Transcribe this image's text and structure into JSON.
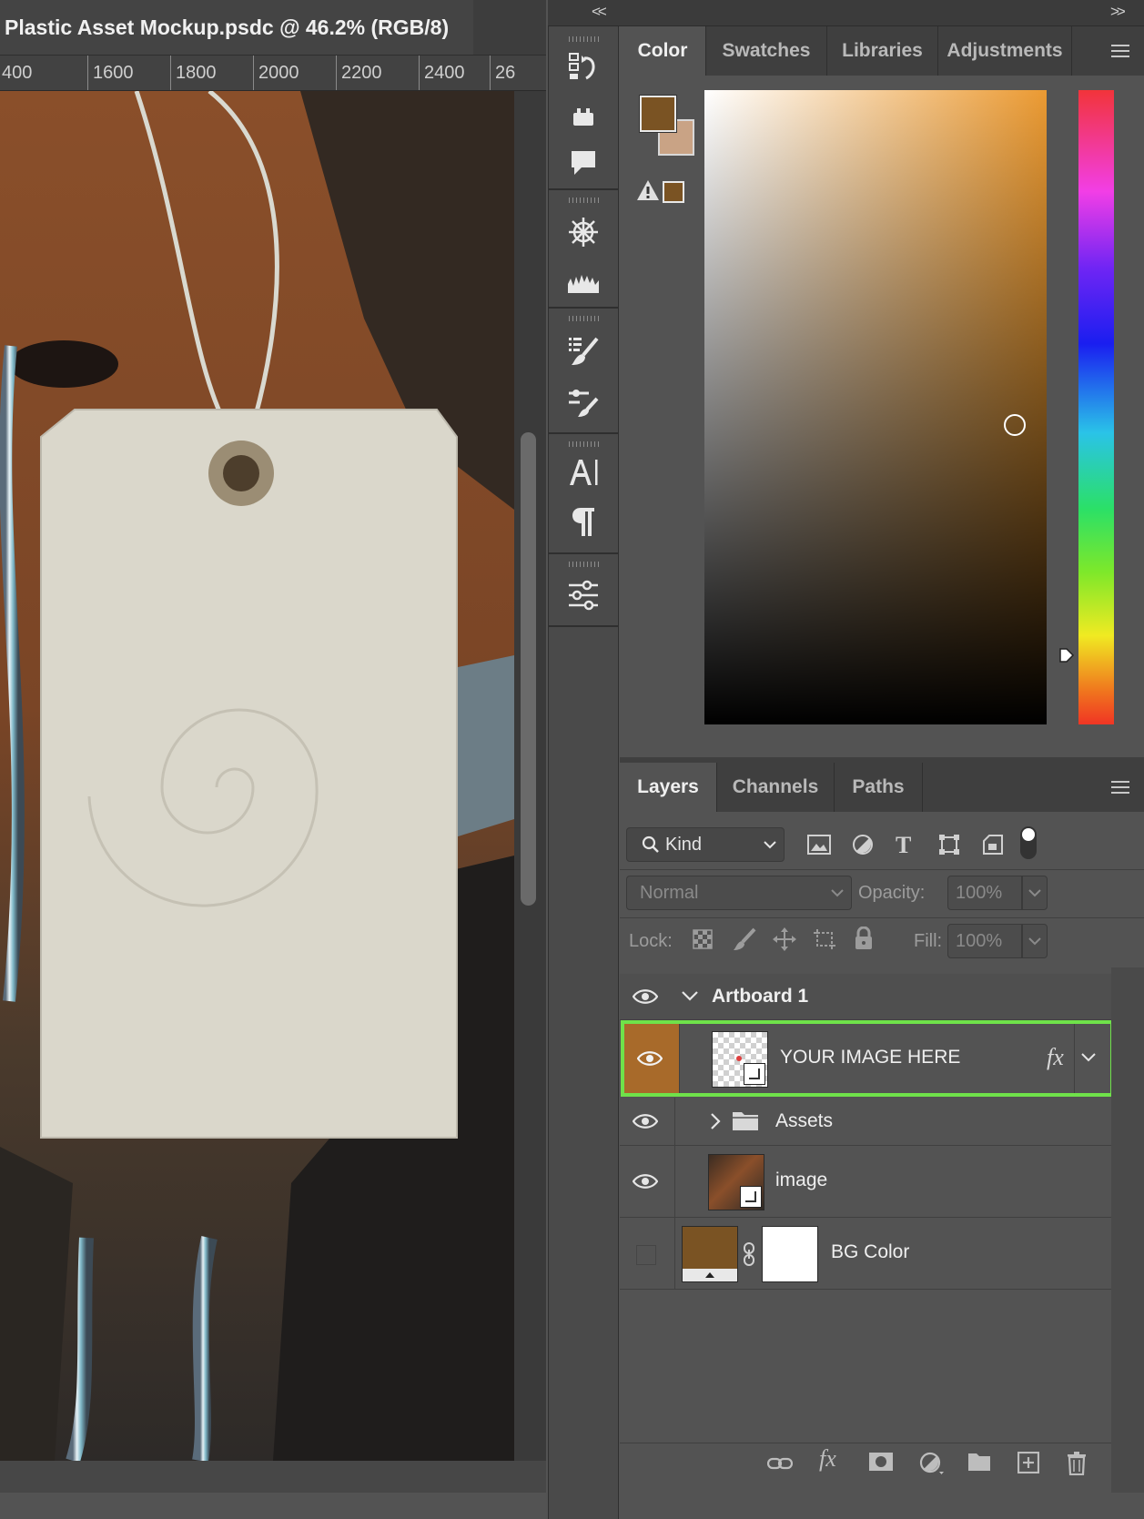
{
  "document": {
    "tab_title": "Plastic Asset Mockup.psdc @ 46.2% (RGB/8)",
    "ruler_labels": [
      "400",
      "1600",
      "1800",
      "2000",
      "2200",
      "2400",
      "26"
    ]
  },
  "toolstrip": {
    "collapse_left": "<<",
    "collapse_right": ">>"
  },
  "color_panel": {
    "tabs": [
      "Color",
      "Swatches",
      "Libraries",
      "Adjustments"
    ],
    "active_tab": "Color",
    "foreground_color": "#7a5323",
    "background_color": "#c9a385",
    "gamut_warning_color": "#7a5323"
  },
  "layers_panel": {
    "tabs": [
      "Layers",
      "Channels",
      "Paths"
    ],
    "active_tab": "Layers",
    "filter_kind": "Kind",
    "blend_mode": "Normal",
    "opacity_label": "Opacity:",
    "opacity_value": "100%",
    "lock_label": "Lock:",
    "fill_label": "Fill:",
    "fill_value": "100%",
    "layers": [
      {
        "name": "Artboard 1",
        "type": "artboard",
        "visible": true
      },
      {
        "name": "YOUR IMAGE HERE",
        "type": "smart-object",
        "visible": true,
        "selected": true,
        "effects": "fx"
      },
      {
        "name": "Assets",
        "type": "group",
        "visible": true
      },
      {
        "name": "image",
        "type": "smart-object",
        "visible": true
      },
      {
        "name": "BG Color",
        "type": "fill",
        "visible": false,
        "fill_color": "#7a5323"
      }
    ],
    "bottom_icons": [
      "link-icon",
      "fx-icon",
      "mask-icon",
      "adjustment-icon",
      "folder-icon",
      "new-layer-icon",
      "trash-icon"
    ]
  },
  "colors": {
    "selection_outline": "#6fe24a",
    "selected_eye_bg": "#a86a2a"
  }
}
